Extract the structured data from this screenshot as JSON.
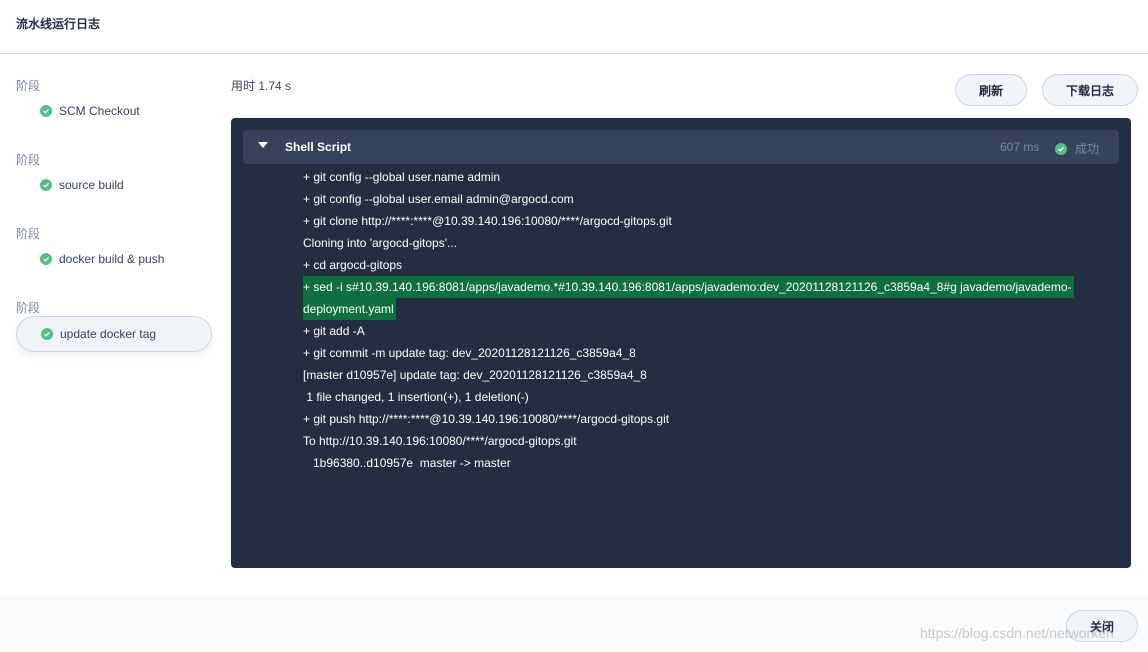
{
  "header": {
    "title": "流水线运行日志"
  },
  "sidebar": {
    "stages": [
      {
        "label": "阶段",
        "item": "SCM Checkout",
        "active": false
      },
      {
        "label": "阶段",
        "item": "source build",
        "active": false
      },
      {
        "label": "阶段",
        "item": "docker build & push",
        "active": false
      },
      {
        "label": "阶段",
        "item": "update docker tag",
        "active": true
      }
    ]
  },
  "main": {
    "duration": "用时 1.74 s",
    "refresh_label": "刷新",
    "download_label": "下载日志"
  },
  "step": {
    "name": "Shell Script",
    "time": "607 ms",
    "status": "成功"
  },
  "log": {
    "lines": [
      "+ git config --global user.name admin",
      "+ git config --global user.email admin@argocd.com",
      "+ git clone http://****:****@10.39.140.196:10080/****/argocd-gitops.git",
      "Cloning into 'argocd-gitops'...",
      "+ cd argocd-gitops",
      "+ sed -i s#10.39.140.196:8081/apps/javademo.*#10.39.140.196:8081/apps/javademo:dev_20201128121126_c3859a4_8#g javademo/javademo-",
      "deployment.yaml",
      "+ git add -A",
      "+ git commit -m update tag: dev_20201128121126_c3859a4_8",
      "[master d10957e] update tag: dev_20201128121126_c3859a4_8",
      " 1 file changed, 1 insertion(+), 1 deletion(-)",
      "+ git push http://****:****@10.39.140.196:10080/****/argocd-gitops.git",
      "To http://10.39.140.196:10080/****/argocd-gitops.git",
      "   1b96380..d10957e  master -> master"
    ],
    "highlighted": [
      5,
      6
    ]
  },
  "footer": {
    "close_label": "关闭"
  },
  "watermark": "https://blog.csdn.net/networken",
  "colors": {
    "success": "#55bc8a",
    "console_bg": "#242e42",
    "step_bar_bg": "#36435c",
    "highlight": "#0f6f3f"
  },
  "icons": {
    "stage_status": "check-circle-icon",
    "step_toggle": "caret-down-icon"
  }
}
